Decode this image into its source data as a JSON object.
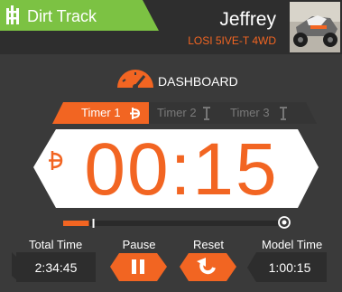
{
  "header": {
    "track_name": "Dirt Track",
    "model_name": "Jeffrey",
    "model_type": "LOSI 5IVE-T 4WD",
    "track_icon": "track-icon",
    "thumbnail": "truck-image"
  },
  "dashboard": {
    "label": "DASHBOARD",
    "icon": "speedometer-icon"
  },
  "timers": {
    "tabs": [
      {
        "label": "Timer 1",
        "active": true,
        "icon": "throttle-icon"
      },
      {
        "label": "Timer 2",
        "active": false,
        "icon": "switch-icon"
      },
      {
        "label": "Timer 3",
        "active": false,
        "icon": "switch-icon"
      }
    ],
    "display": "00:15",
    "trigger_icon": "throttle-icon",
    "progress": 0.12
  },
  "bottom": {
    "total_time_label": "Total Time",
    "total_time_value": "2:34:45",
    "pause_label": "Pause",
    "pause_icon": "pause-icon",
    "reset_label": "Reset",
    "reset_icon": "reset-icon",
    "model_time_label": "Model Time",
    "model_time_value": "1:00:15"
  },
  "colors": {
    "accent": "#f26522",
    "header_green": "#7cc243",
    "background": "#3a3a3a",
    "header_bg": "#2d2d2d",
    "inactive_tab": "#6b6b6b"
  }
}
